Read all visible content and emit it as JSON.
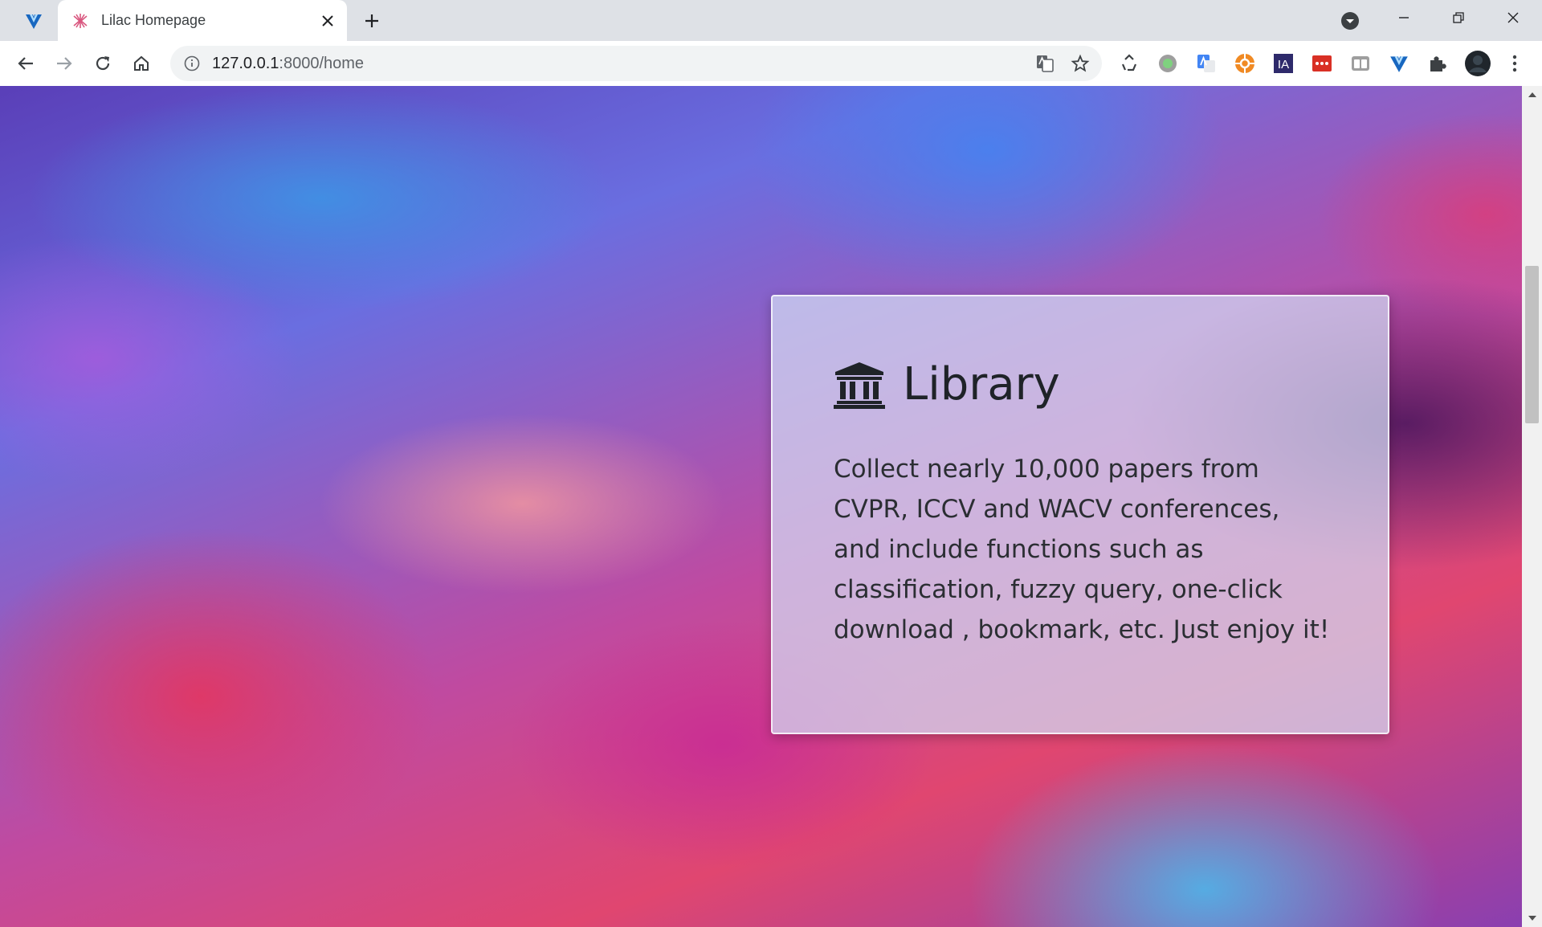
{
  "browser": {
    "tab": {
      "title": "Lilac Homepage"
    },
    "url": {
      "host": "127.0.0.1",
      "rest": ":8000/home"
    },
    "extensions": [
      "recycle-icon",
      "green-dot-icon",
      "google-translate-icon",
      "orange-circle-icon",
      "ia-icon",
      "red-dots-icon",
      "tabs-icon",
      "vuetify-icon",
      "puzzle-icon"
    ],
    "extension_labels": {
      "ia": "IA"
    }
  },
  "card": {
    "title": "Library",
    "description": "Collect nearly 10,000 papers from CVPR, ICCV and WACV conferences, and include functions such as classification, fuzzy query, one-click download , bookmark, etc. Just enjoy it!"
  },
  "colors": {
    "tab_strip": "#dee1e6",
    "toolbar": "#ffffff",
    "omnibox": "#f1f3f4",
    "card_text": "#2b2e33"
  }
}
